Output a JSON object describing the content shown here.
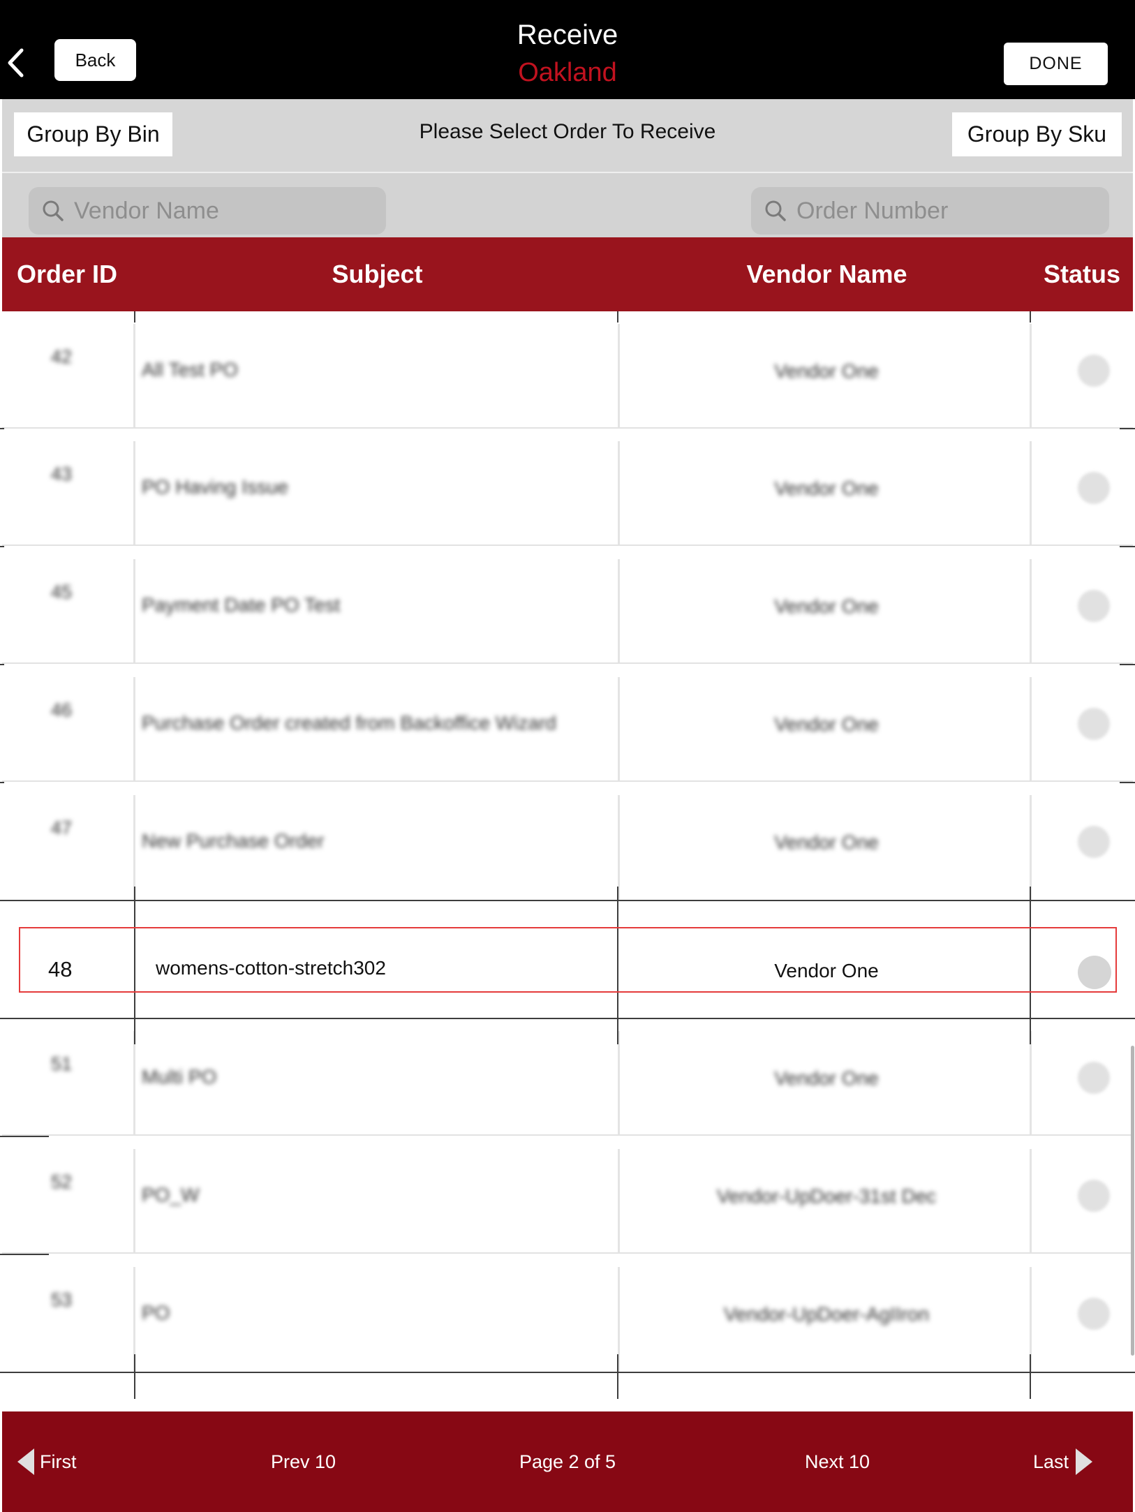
{
  "nav": {
    "back_label": "Back",
    "title": "Receive",
    "subtitle": "Oakland",
    "done_label": "DONE"
  },
  "group_bar": {
    "left_label": "Group By Bin",
    "instruction": "Please Select Order To Receive",
    "right_label": "Group By Sku"
  },
  "search": {
    "vendor_placeholder": "Vendor Name",
    "order_placeholder": "Order Number"
  },
  "table": {
    "headers": {
      "order_id": "Order ID",
      "subject": "Subject",
      "vendor": "Vendor Name",
      "status": "Status"
    },
    "rows": [
      {
        "id": "42",
        "subject": "All Test PO",
        "vendor": "Vendor One"
      },
      {
        "id": "43",
        "subject": "PO Having Issue",
        "vendor": "Vendor One"
      },
      {
        "id": "45",
        "subject": "Payment Date PO Test",
        "vendor": "Vendor One"
      },
      {
        "id": "46",
        "subject": "Purchase Order created from Backoffice Wizard",
        "vendor": "Vendor One"
      },
      {
        "id": "47",
        "subject": "New Purchase Order",
        "vendor": "Vendor One"
      },
      {
        "id": "48",
        "subject": "womens-cotton-stretch302",
        "vendor": "Vendor One",
        "selected": true
      },
      {
        "id": "51",
        "subject": "Multi PO",
        "vendor": "Vendor One"
      },
      {
        "id": "52",
        "subject": "PO_W",
        "vendor": "Vendor-UpDoer-31st Dec"
      },
      {
        "id": "53",
        "subject": "PO",
        "vendor": "Vendor-UpDoer-AgIIron"
      }
    ]
  },
  "pagination": {
    "first": "First",
    "prev": "Prev 10",
    "page": "Page 2 of 5",
    "next": "Next 10",
    "last": "Last"
  },
  "colors": {
    "nav_bg": "#000000",
    "accent_red": "#c1121f",
    "header_bg": "#99141d",
    "footer_bg": "#870814",
    "selected_border": "#e53b3b"
  }
}
